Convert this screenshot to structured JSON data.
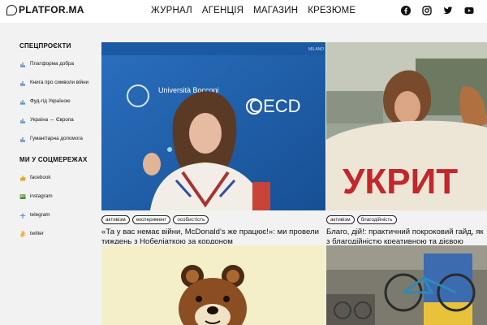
{
  "header": {
    "logo": "PLATFOR.MA",
    "nav": [
      "ЖУРНАЛ",
      "АГЕНЦІЯ",
      "МАГАЗИН",
      "КРЕЗЮМЕ"
    ],
    "social": [
      "facebook-icon",
      "instagram-icon",
      "twitter-icon",
      "youtube-icon"
    ]
  },
  "sidebar": {
    "special_heading": "СПЕЦПРОЄКТИ",
    "special_items": [
      "Платформа добра",
      "Книга про символи війни",
      "Фуд-гід Україною",
      "Україна ⇔ Європа",
      "Гуманітарна допомога"
    ],
    "social_heading": "МИ У СОЦМЕРЕЖАХ",
    "social_items": [
      "facebook",
      "instagram",
      "telegram",
      "twitter"
    ]
  },
  "articles": [
    {
      "tags": [
        "активізм",
        "експеримент",
        "особистість"
      ],
      "title": "«Та у вас немає війни, McDonald’s же працює!»: ми провели тиждень з Нобеліаткою за кордоном",
      "image_text": [
        "Università Bocconi",
        "OECD",
        "MILANO"
      ]
    },
    {
      "tags": [
        "активізм",
        "благодійність"
      ],
      "title": "Благо, дій!: практичний покроковий гайд, як з благодійністю креативною та дієвою",
      "image_text": [
        "УКРИТ"
      ]
    }
  ],
  "colors": {
    "bg": "#f2f2f2",
    "header_bg": "#ffffff",
    "stage_blue": "#1f5fa8",
    "cream": "#f5efc9"
  }
}
